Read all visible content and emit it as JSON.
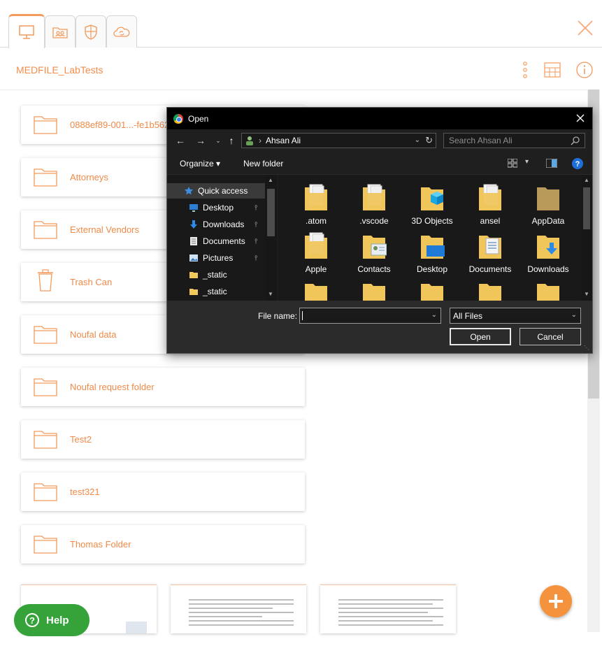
{
  "window": {
    "breadcrumb": "MEDFILE_LabTests"
  },
  "tabs": [
    {
      "icon": "monitor-icon",
      "active": true
    },
    {
      "icon": "users-folder-icon",
      "active": false
    },
    {
      "icon": "shield-icon",
      "active": false
    },
    {
      "icon": "cloud-sync-icon",
      "active": false
    }
  ],
  "folders": [
    {
      "name": "0888ef89-001...-fe1b562",
      "icon": "folder-icon"
    },
    {
      "name": "Attorneys",
      "icon": "folder-icon"
    },
    {
      "name": "External Vendors",
      "icon": "folder-icon"
    },
    {
      "name": "Trash Can",
      "icon": "trash-icon"
    },
    {
      "name": "Noufal data",
      "icon": "folder-icon"
    },
    {
      "name": "Noufal request folder",
      "icon": "folder-icon"
    },
    {
      "name": " Test2",
      "icon": "folder-icon"
    },
    {
      "name": "test321",
      "icon": "folder-icon"
    },
    {
      "name": "Thomas Folder",
      "icon": "folder-icon"
    }
  ],
  "help": {
    "label": "Help"
  },
  "colors": {
    "accent": "#f28e4c",
    "help_green": "#36a33a",
    "dialog_bg": "#1f1f1f"
  },
  "dialog": {
    "title": "Open",
    "path": "Ahsan Ali",
    "search_placeholder": "Search Ahsan Ali",
    "organize_label": "Organize",
    "new_folder_label": "New folder",
    "nav_items": [
      {
        "label": "Quick access",
        "icon": "star-icon",
        "pinned": false
      },
      {
        "label": "Desktop",
        "icon": "desktop-icon",
        "pinned": true
      },
      {
        "label": "Downloads",
        "icon": "download-icon",
        "pinned": true
      },
      {
        "label": "Documents",
        "icon": "documents-icon",
        "pinned": true
      },
      {
        "label": "Pictures",
        "icon": "pictures-icon",
        "pinned": true
      },
      {
        "label": "_static",
        "icon": "folder-icon",
        "pinned": false
      },
      {
        "label": "_static",
        "icon": "folder-icon",
        "pinned": false
      }
    ],
    "files_row1": [
      ".atom",
      ".vscode",
      "3D Objects",
      "ansel",
      "AppData"
    ],
    "files_row2": [
      "Apple",
      "Contacts",
      "Desktop",
      "Documents",
      "Downloads"
    ],
    "file_name_label": "File name:",
    "file_name_value": "",
    "file_type": "All Files",
    "open_label": "Open",
    "cancel_label": "Cancel"
  }
}
